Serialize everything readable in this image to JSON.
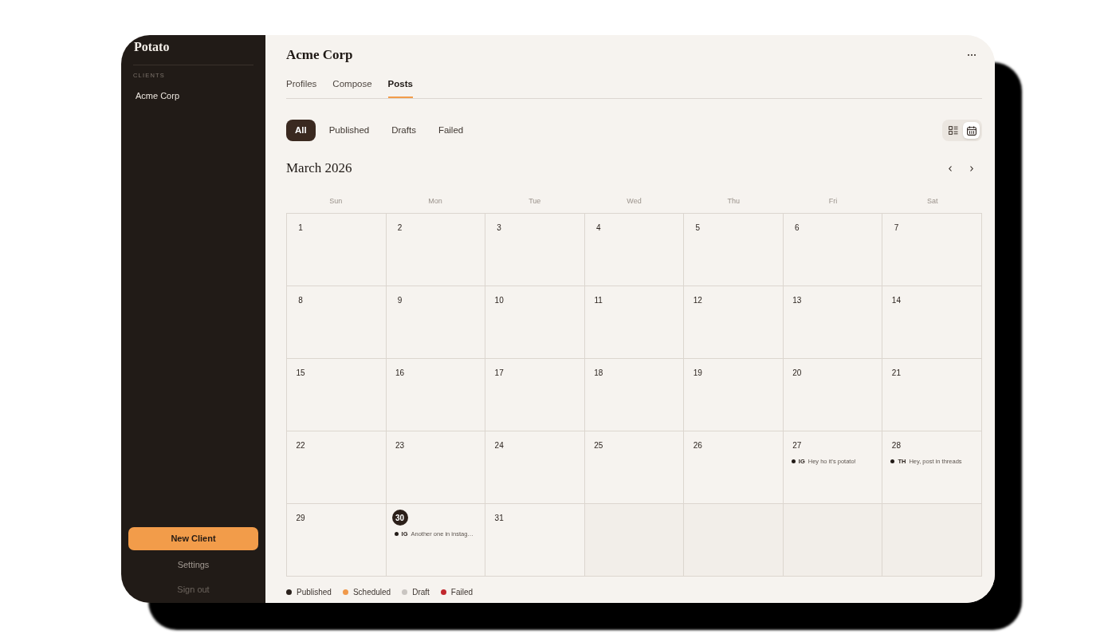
{
  "sidebar": {
    "logo": "Potato",
    "section_label": "CLIENTS",
    "clients": [
      {
        "name": "Acme Corp"
      }
    ],
    "new_client_button": "New Client",
    "links": [
      {
        "label": "Settings",
        "kind": "settings"
      },
      {
        "label": "Sign out",
        "kind": "sign_out"
      }
    ]
  },
  "header": {
    "title": "Acme Corp"
  },
  "tabs": [
    {
      "label": "Profiles",
      "selected": false
    },
    {
      "label": "Compose",
      "selected": false
    },
    {
      "label": "Posts",
      "selected": true
    }
  ],
  "filters": [
    {
      "label": "All",
      "selected": true
    },
    {
      "label": "Published",
      "selected": false
    },
    {
      "label": "Drafts",
      "selected": false
    },
    {
      "label": "Failed",
      "selected": false
    }
  ],
  "views": [
    {
      "kind": "list",
      "selected": false
    },
    {
      "kind": "calendar",
      "selected": true
    }
  ],
  "calendar": {
    "month": "March 2026",
    "weekdays": [
      "Sun",
      "Mon",
      "Tue",
      "Wed",
      "Thu",
      "Fri",
      "Sat"
    ],
    "weeks": [
      [
        {
          "kind": "day",
          "day": "1",
          "today": false
        },
        {
          "kind": "day",
          "day": "2",
          "today": false
        },
        {
          "kind": "day",
          "day": "3",
          "today": false
        },
        {
          "kind": "day",
          "day": "4",
          "today": false
        },
        {
          "kind": "day",
          "day": "5",
          "today": false
        },
        {
          "kind": "day",
          "day": "6",
          "today": false
        },
        {
          "kind": "day",
          "day": "7",
          "today": false
        }
      ],
      [
        {
          "kind": "day",
          "day": "8",
          "today": false
        },
        {
          "kind": "day",
          "day": "9",
          "today": false
        },
        {
          "kind": "day",
          "day": "10",
          "today": false
        },
        {
          "kind": "day",
          "day": "11",
          "today": false
        },
        {
          "kind": "day",
          "day": "12",
          "today": false
        },
        {
          "kind": "day",
          "day": "13",
          "today": false
        },
        {
          "kind": "day",
          "day": "14",
          "today": false
        }
      ],
      [
        {
          "kind": "day",
          "day": "15",
          "today": false
        },
        {
          "kind": "day",
          "day": "16",
          "today": false
        },
        {
          "kind": "day",
          "day": "17",
          "today": false
        },
        {
          "kind": "day",
          "day": "18",
          "today": false
        },
        {
          "kind": "day",
          "day": "19",
          "today": false
        },
        {
          "kind": "day",
          "day": "20",
          "today": false
        },
        {
          "kind": "day",
          "day": "21",
          "today": false
        }
      ],
      [
        {
          "kind": "day",
          "day": "22",
          "today": false
        },
        {
          "kind": "day",
          "day": "23",
          "today": false
        },
        {
          "kind": "day",
          "day": "24",
          "today": false
        },
        {
          "kind": "day",
          "day": "25",
          "today": false
        },
        {
          "kind": "day",
          "day": "26",
          "today": false
        },
        {
          "kind": "day",
          "day": "27",
          "today": false,
          "posts": [
            {
              "platform": "IG",
              "text": "Hey ho it’s potato!",
              "color": "#231c18"
            }
          ]
        },
        {
          "kind": "day",
          "day": "28",
          "today": false,
          "posts": [
            {
              "platform": "TH",
              "text": "Hey, post in threads",
              "color": "#231c18"
            }
          ]
        }
      ],
      [
        {
          "kind": "day",
          "day": "29",
          "today": false
        },
        {
          "kind": "day",
          "day": "30",
          "today": true,
          "posts": [
            {
              "platform": "IG",
              "text": "Another one in instag…",
              "color": "#231c18"
            }
          ]
        },
        {
          "kind": "day",
          "day": "31",
          "today": false
        },
        {
          "kind": "empty"
        },
        {
          "kind": "empty"
        },
        {
          "kind": "empty"
        },
        {
          "kind": "empty"
        }
      ]
    ]
  },
  "legend": [
    {
      "label": "Published",
      "color": "#2a211c"
    },
    {
      "label": "Scheduled",
      "color": "#f0994a"
    },
    {
      "label": "Draft",
      "color": "#c9c5c1"
    },
    {
      "label": "Failed",
      "color": "#c1272d"
    }
  ]
}
